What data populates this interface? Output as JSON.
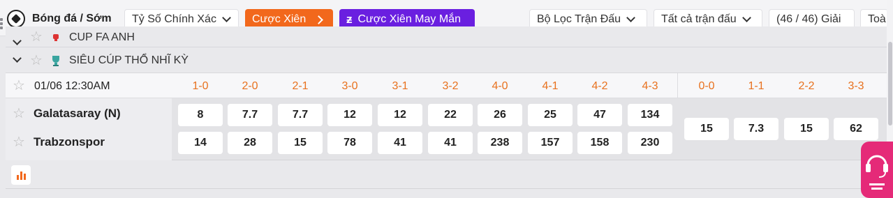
{
  "toolbar": {
    "brand": "Bóng đá / Sớm",
    "market_select": "Tỷ Số Chính Xác",
    "parlay_button": "Cược Xiên",
    "lucky_parlay_button": "Cược Xiên May Mắn",
    "match_filter": "Bộ Lọc Trận Đấu",
    "all_matches": "Tất cả trận đấu",
    "league_count": "(46 / 46) Giải",
    "cut_off_button": "Toà"
  },
  "leagues": [
    {
      "name": "CUP FA ANH"
    },
    {
      "name": "SIÊU CÚP THỔ NHĨ KỲ"
    }
  ],
  "match": {
    "datetime": "01/06 12:30AM",
    "score_headers": [
      "1-0",
      "2-0",
      "2-1",
      "3-0",
      "3-1",
      "3-2",
      "4-0",
      "4-1",
      "4-2",
      "4-3"
    ],
    "draw_headers": [
      "0-0",
      "1-1",
      "2-2",
      "3-3"
    ],
    "home": {
      "name": "Galatasaray (N)",
      "odds": [
        "8",
        "7.7",
        "7.7",
        "12",
        "12",
        "22",
        "26",
        "25",
        "47",
        "134"
      ]
    },
    "away": {
      "name": "Trabzonspor",
      "odds": [
        "14",
        "28",
        "15",
        "78",
        "41",
        "41",
        "238",
        "157",
        "158",
        "230"
      ]
    },
    "draw_odds": [
      "15",
      "7.3",
      "15",
      "62"
    ]
  },
  "colors": {
    "accent_orange": "#f2681c",
    "accent_purple": "#6a1fe0",
    "score_header": "#e8711e",
    "support_pink": "#e52a78"
  },
  "icons": [
    "football-icon",
    "chevron-down-icon",
    "chevron-right-icon",
    "star-icon",
    "trophy-icon",
    "stats-icon",
    "headset-icon"
  ]
}
